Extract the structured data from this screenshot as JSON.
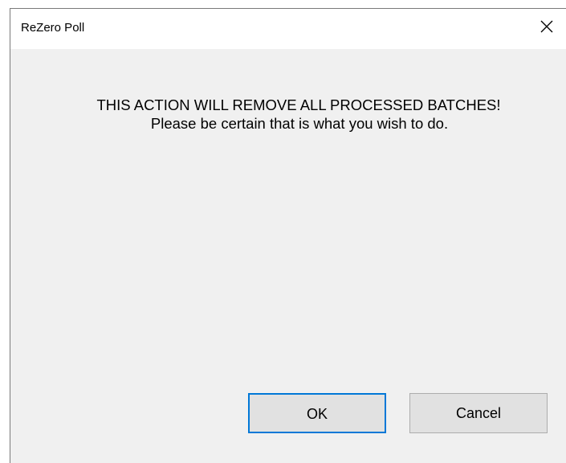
{
  "window": {
    "title": "ReZero Poll",
    "close_icon": "close-icon"
  },
  "message": {
    "line1": "THIS ACTION WILL REMOVE ALL PROCESSED BATCHES!",
    "line2": "Please be certain that is what you wish to do."
  },
  "buttons": {
    "ok_label": "OK",
    "cancel_label": "Cancel"
  },
  "colors": {
    "dialog_background": "#f0f0f0",
    "titlebar_background": "#ffffff",
    "button_background": "#e1e1e1",
    "default_button_border": "#0078d7"
  }
}
